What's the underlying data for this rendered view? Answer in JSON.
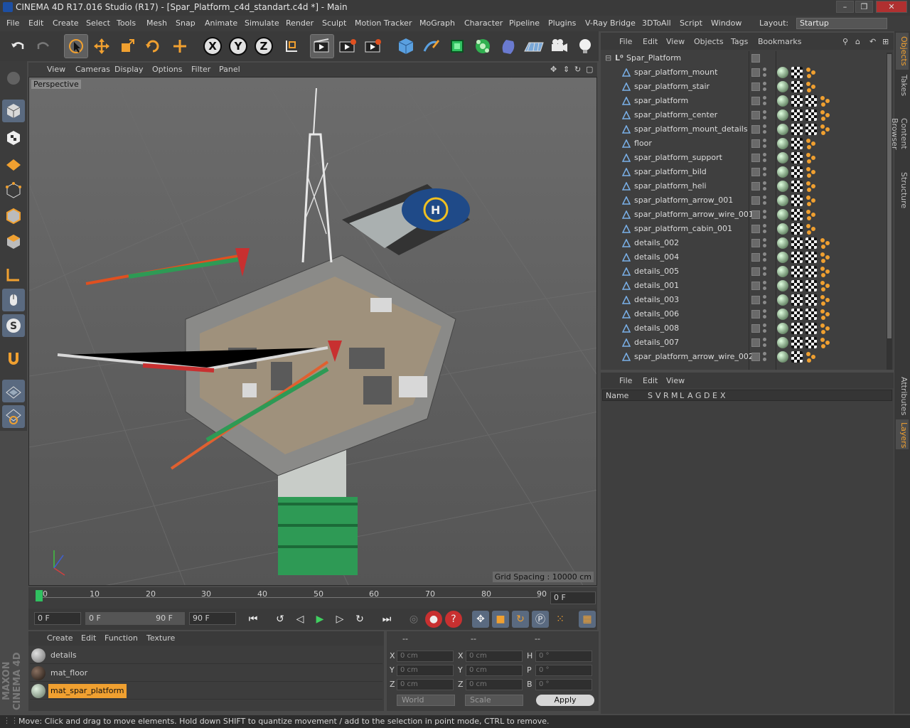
{
  "window": {
    "title": "CINEMA 4D R17.016 Studio (R17) - [Spar_Platform_c4d_standart.c4d *] - Main",
    "controls": [
      "–",
      "❐",
      "✕"
    ]
  },
  "menu": {
    "items": [
      "File",
      "Edit",
      "Create",
      "Select",
      "Tools",
      "Mesh",
      "Snap",
      "Animate",
      "Simulate",
      "Render",
      "Sculpt",
      "Motion Tracker",
      "MoGraph",
      "Character",
      "Pipeline",
      "Plugins",
      "V-Ray Bridge",
      "3DToAll",
      "Script",
      "Window"
    ],
    "layout_label": "Layout:",
    "layout_value": "Startup"
  },
  "toolbar": {
    "axis_x": "X",
    "axis_y": "Y",
    "axis_z": "Z"
  },
  "viewport": {
    "menu": [
      "View",
      "Cameras",
      "Display",
      "Options",
      "Filter",
      "Panel"
    ],
    "camera_label": "Perspective",
    "grid_spacing": "Grid Spacing : 10000 cm"
  },
  "timeline": {
    "ticks": [
      "0",
      "10",
      "20",
      "30",
      "40",
      "50",
      "60",
      "70",
      "80",
      "90"
    ],
    "end_field": "0 F",
    "current_frame": "0 F",
    "range_start": "0 F",
    "range_end_inner": "90 F",
    "range_end": "90 F"
  },
  "material_manager": {
    "menu": [
      "Create",
      "Edit",
      "Function",
      "Texture"
    ],
    "materials": [
      {
        "name": "details",
        "color": "#9a9a9a",
        "selected": false
      },
      {
        "name": "mat_floor",
        "color": "#3a3028",
        "selected": false
      },
      {
        "name": "mat_spar_platform",
        "color": "#a8b8a8",
        "selected": true
      }
    ]
  },
  "coordinates": {
    "header": [
      "--",
      "--",
      "--"
    ],
    "rows": [
      {
        "l1": "X",
        "v1": "0 cm",
        "l2": "X",
        "v2": "0 cm",
        "l3": "H",
        "v3": "0 °"
      },
      {
        "l1": "Y",
        "v1": "0 cm",
        "l2": "Y",
        "v2": "0 cm",
        "l3": "P",
        "v3": "0 °"
      },
      {
        "l1": "Z",
        "v1": "0 cm",
        "l2": "Z",
        "v2": "0 cm",
        "l3": "B",
        "v3": "0 °"
      }
    ],
    "mode": "World",
    "scale": "Scale",
    "apply": "Apply"
  },
  "object_manager": {
    "menu": [
      "File",
      "Edit",
      "View",
      "Objects",
      "Tags",
      "Bookmarks"
    ],
    "root": "Spar_Platform",
    "objects": [
      {
        "name": "spar_platform_mount",
        "tags": 3
      },
      {
        "name": "spar_platform_stair",
        "tags": 3
      },
      {
        "name": "spar_platform",
        "tags": 4
      },
      {
        "name": "spar_platform_center",
        "tags": 4
      },
      {
        "name": "spar_platform_mount_details",
        "tags": 4
      },
      {
        "name": "floor",
        "tags": 3
      },
      {
        "name": "spar_platform_support",
        "tags": 3
      },
      {
        "name": "spar_platform_bild",
        "tags": 3
      },
      {
        "name": "spar_platform_heli",
        "tags": 3
      },
      {
        "name": "spar_platform_arrow_001",
        "tags": 3
      },
      {
        "name": "spar_platform_arrow_wire_001",
        "tags": 3
      },
      {
        "name": "spar_platform_cabin_001",
        "tags": 3
      },
      {
        "name": "details_002",
        "tags": 4
      },
      {
        "name": "details_004",
        "tags": 4
      },
      {
        "name": "details_005",
        "tags": 4
      },
      {
        "name": "details_001",
        "tags": 4
      },
      {
        "name": "details_003",
        "tags": 4
      },
      {
        "name": "details_006",
        "tags": 4
      },
      {
        "name": "details_008",
        "tags": 4
      },
      {
        "name": "details_007",
        "tags": 4
      },
      {
        "name": "spar_platform_arrow_wire_002",
        "tags": 3
      }
    ]
  },
  "attribute_manager": {
    "menu": [
      "File",
      "Edit",
      "View"
    ],
    "columns": [
      "Name",
      "S",
      "V",
      "R",
      "M",
      "L",
      "A",
      "G",
      "D",
      "E",
      "X"
    ]
  },
  "side_tabs": [
    {
      "label": "Objects",
      "active": true
    },
    {
      "label": "Takes",
      "active": false
    },
    {
      "label": "Content Browser",
      "active": false
    },
    {
      "label": "Structure",
      "active": false
    },
    {
      "label": "Attributes",
      "active": false
    },
    {
      "label": "Layers",
      "active": true
    }
  ],
  "status": {
    "text": "Move: Click and drag to move elements. Hold down SHIFT to quantize movement / add to the selection in point mode, CTRL to remove."
  },
  "logo": {
    "text": "MAXON CINEMA 4D"
  }
}
